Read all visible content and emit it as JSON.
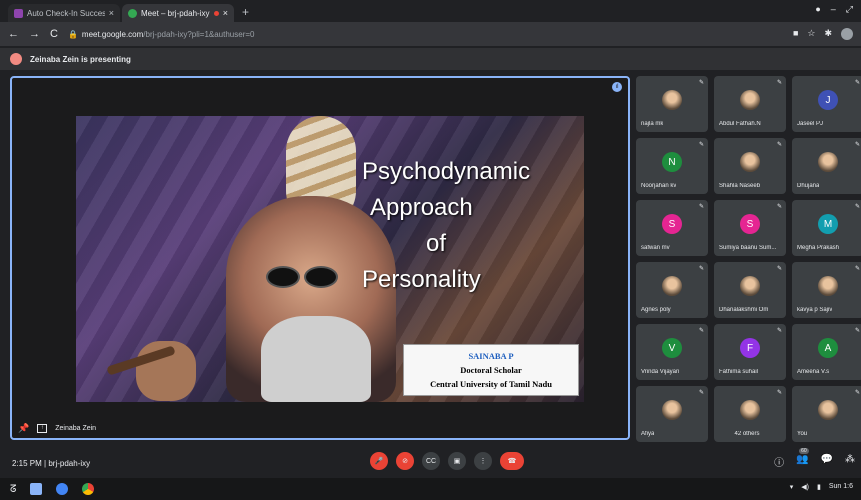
{
  "browser": {
    "tabs": [
      {
        "label": "Auto Check-In Success",
        "fav_color": "#8e44ad",
        "active": false
      },
      {
        "label": "Meet – brj-pdah-ixy",
        "fav_color": "#34a853",
        "active": true
      }
    ],
    "new_tab": "+",
    "url_host": "meet.google.com",
    "url_path": "/brj-pdah-ixy?pli=1&authuser=0",
    "nav_back": "←",
    "nav_fwd": "→",
    "nav_reload": "C"
  },
  "presenting_banner": "Zeinaba Zein is presenting",
  "slide": {
    "title_lines": [
      "Psychodynamic",
      "Approach",
      "of",
      "Personality"
    ],
    "presenter_name": "SAINABA P",
    "presenter_role": "Doctoral Scholar",
    "presenter_org": "Central University of Tamil Nadu"
  },
  "stage_footer": {
    "name": "Zeinaba Zein"
  },
  "participants": [
    {
      "name": "najla mk",
      "initial": "",
      "color": "#5f6368",
      "photo": true
    },
    {
      "name": "Abdul Fathah.N",
      "initial": "",
      "color": "#5f6368",
      "photo": true
    },
    {
      "name": "Jaseel PJ",
      "initial": "J",
      "color": "#3f51b5",
      "photo": false
    },
    {
      "name": "Noorjahan kv",
      "initial": "N",
      "color": "#1e8e3e",
      "photo": false
    },
    {
      "name": "Shahla Naseeb",
      "initial": "",
      "color": "#5f6368",
      "photo": true
    },
    {
      "name": "Dhujana",
      "initial": "",
      "color": "#5f6368",
      "photo": true
    },
    {
      "name": "safwan mv",
      "initial": "S",
      "color": "#e52592",
      "photo": false
    },
    {
      "name": "Sumiya baanu Sum...",
      "initial": "S",
      "color": "#e52592",
      "photo": false
    },
    {
      "name": "Megha Prakash",
      "initial": "M",
      "color": "#129eaf",
      "photo": false
    },
    {
      "name": "Agnes poly",
      "initial": "",
      "color": "#f9ab00",
      "photo": true
    },
    {
      "name": "Dhanalakshmi Om",
      "initial": "",
      "color": "#5f6368",
      "photo": true
    },
    {
      "name": "kavya p Sajiv",
      "initial": "",
      "color": "#5f6368",
      "photo": true
    },
    {
      "name": "Vrinda Vijayan",
      "initial": "V",
      "color": "#1e8e3e",
      "photo": false
    },
    {
      "name": "Fathima suhail",
      "initial": "F",
      "color": "#9334e6",
      "photo": false
    },
    {
      "name": "Ameena V.s",
      "initial": "A",
      "color": "#1e8e3e",
      "photo": false
    },
    {
      "name": "Afiya",
      "initial": "",
      "color": "#5f6368",
      "photo": true
    },
    {
      "name": "42 others",
      "initial": "",
      "color": "#5f6368",
      "photo": true
    },
    {
      "name": "You",
      "initial": "",
      "color": "#5f6368",
      "photo": true
    }
  ],
  "bottom": {
    "time": "2:15 PM",
    "separator": "|",
    "meeting_code": "brj-pdah-ixy",
    "people_count": "60"
  },
  "taskbar": {
    "clock": "Sun 1:6"
  },
  "colors": {
    "stage_border": "#8ab4f8",
    "hangup": "#ea4335"
  }
}
